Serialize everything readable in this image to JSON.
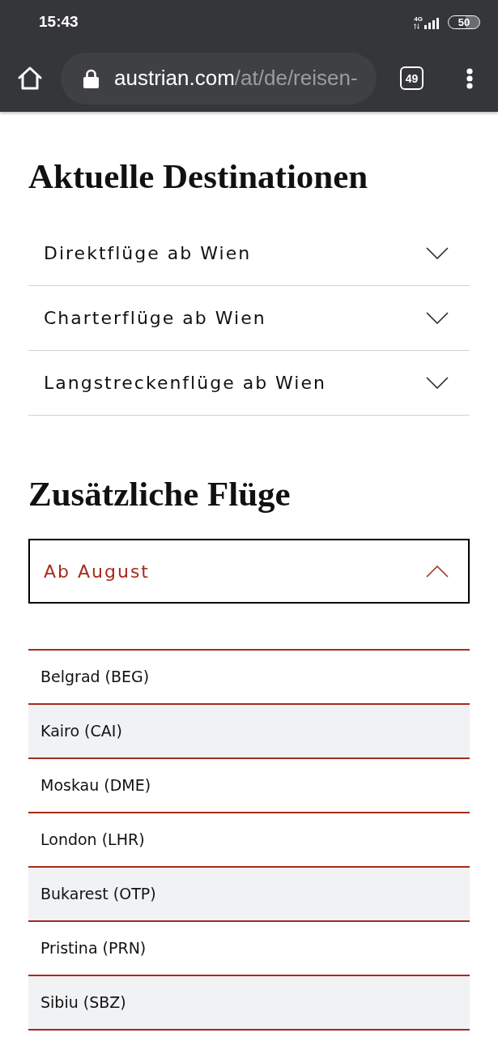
{
  "status_bar": {
    "time": "15:43",
    "network": "4G",
    "battery": "50"
  },
  "browser_toolbar": {
    "url_domain": "austrian.com",
    "url_path": "/at/de/reisen-",
    "tab_count": "49"
  },
  "sections": [
    {
      "heading": "Aktuelle Destinationen",
      "accordions": [
        {
          "label": "Direktflüge ab Wien",
          "expanded": false
        },
        {
          "label": "Charterflüge ab Wien",
          "expanded": false
        },
        {
          "label": "Langstreckenflüge ab Wien",
          "expanded": false
        }
      ]
    },
    {
      "heading": "Zusätzliche Flüge",
      "accordions": [
        {
          "label": "Ab August",
          "expanded": true,
          "destinations": [
            {
              "name": "Belgrad (BEG)",
              "shaded": false
            },
            {
              "name": "Kairo (CAI)",
              "shaded": true
            },
            {
              "name": "Moskau (DME)",
              "shaded": false
            },
            {
              "name": "London (LHR)",
              "shaded": false
            },
            {
              "name": "Bukarest (OTP)",
              "shaded": true
            },
            {
              "name": "Pristina (PRN)",
              "shaded": false
            },
            {
              "name": "Sibiu (SBZ)",
              "shaded": true
            }
          ]
        }
      ]
    }
  ]
}
